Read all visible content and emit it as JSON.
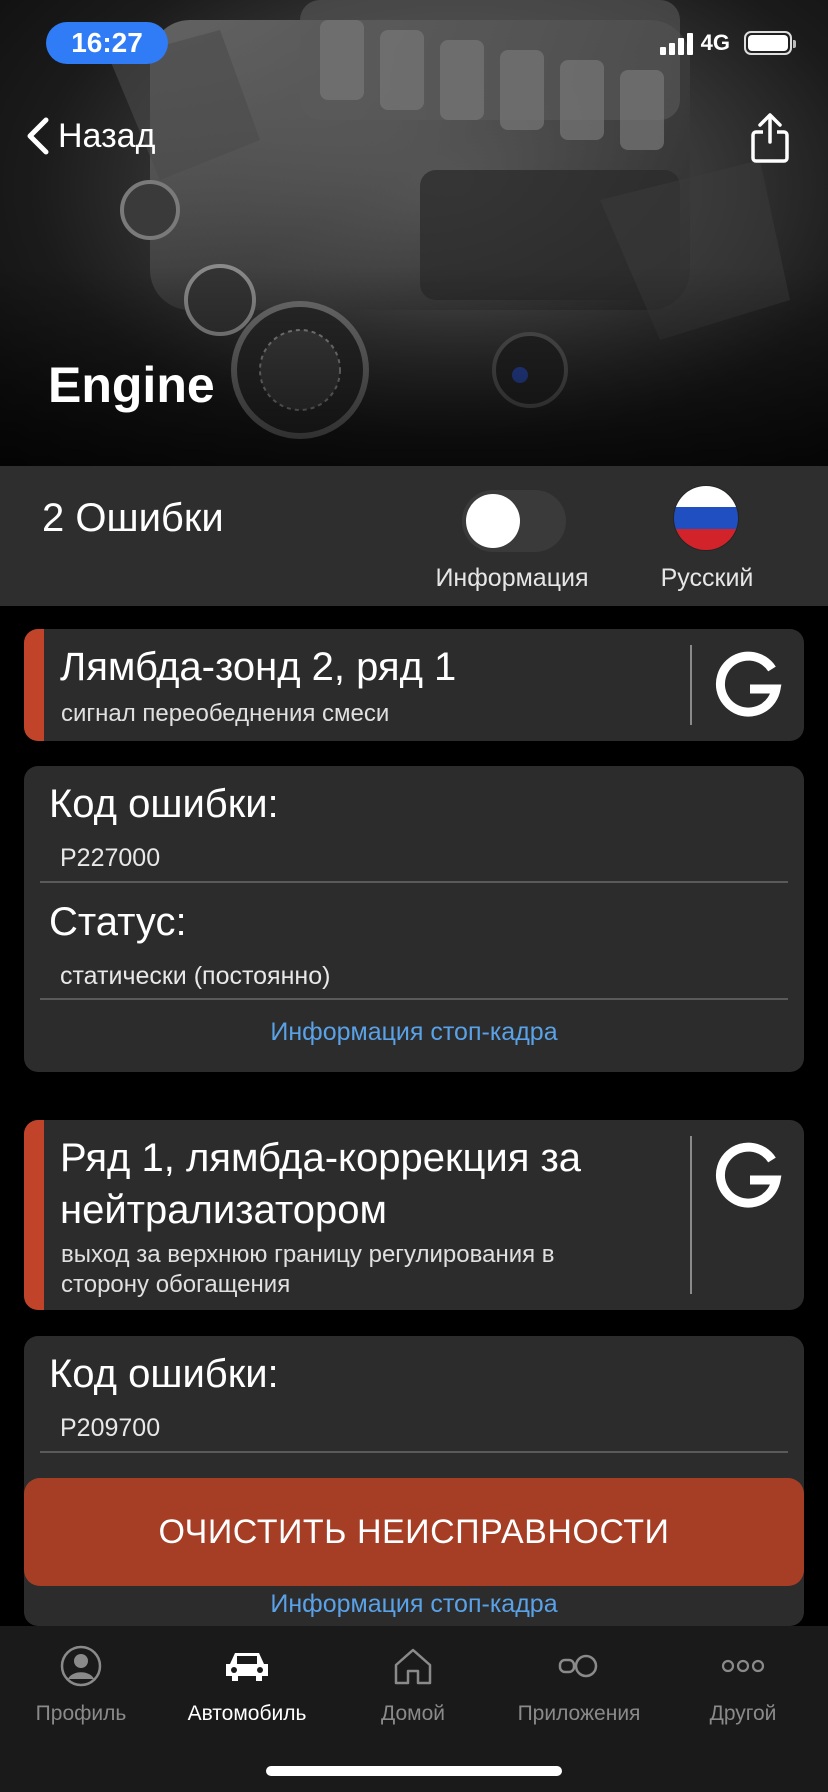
{
  "status_bar": {
    "time": "16:27",
    "network": "4G",
    "signal_bars": 4,
    "battery_level": 1.0
  },
  "header": {
    "back_label": "Назад",
    "title": "Engine",
    "share_icon": "share-icon"
  },
  "summary": {
    "error_count": "2 Ошибки",
    "info_toggle_label": "Информация",
    "info_toggle_on": false,
    "language_label": "Русский",
    "flag_colors": [
      "#ffffff",
      "#1f4fc0",
      "#d3232a"
    ]
  },
  "accent_color": "#c0432a",
  "link_color": "#5aa2e8",
  "faults": [
    {
      "title": "Лямбда-зонд 2, ряд 1",
      "description": "сигнал переобеднения смеси",
      "code_label": "Код ошибки:",
      "code": "P227000",
      "status_label": "Статус:",
      "status": "статически (постоянно)",
      "freeze_frame_link": "Информация стоп-кадра"
    },
    {
      "title_line1": "Ряд 1, лямбда-коррекция за",
      "title_line2": "нейтрализатором",
      "description_line1": "выход за верхнюю границу регулирования в",
      "description_line2": "сторону обогащения",
      "code_label": "Код ошибки:",
      "code": "P209700",
      "freeze_frame_link": "Информация стоп-кадра"
    }
  ],
  "clear_button": "ОЧИСТИТЬ НЕИСПРАВНОСТИ",
  "tabs": [
    {
      "label": "Профиль",
      "icon": "profile-icon",
      "active": false
    },
    {
      "label": "Автомобиль",
      "icon": "car-icon",
      "active": true
    },
    {
      "label": "Домой",
      "icon": "home-icon",
      "active": false
    },
    {
      "label": "Приложения",
      "icon": "apps-icon",
      "active": false
    },
    {
      "label": "Другой",
      "icon": "more-icon",
      "active": false
    }
  ]
}
